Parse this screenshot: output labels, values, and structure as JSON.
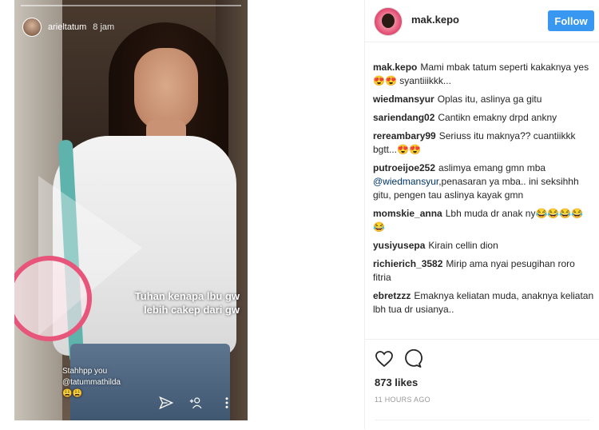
{
  "story": {
    "username": "arieltatum",
    "time": "8 jam",
    "caption_line1": "Tuhan kenapa lbu gw",
    "caption_line2": "lebih cakep dari gw",
    "reply_line1": "Stahhpp you",
    "reply_line2": "@tatummathilda",
    "reply_emoji": "😩😩",
    "footer_icons": [
      "send-icon",
      "add-person-icon",
      "more-icon"
    ]
  },
  "post": {
    "username": "mak.kepo",
    "follow_label": "Follow",
    "likes": "873 likes",
    "timestamp": "11 HOURS AGO",
    "accent_color": "#3897f0"
  },
  "comments": [
    {
      "user": "mak.kepo",
      "text": "Mami mbak tatum seperti kakaknya yes 😍😍 syantiiikkk..."
    },
    {
      "user": "wiedmansyur",
      "text": "Oplas itu, aslinya ga gitu"
    },
    {
      "user": "sariendang02",
      "text": "Cantikn emakny drpd ankny"
    },
    {
      "user": "rereambary99",
      "text": "Seriuss itu maknya?? cuantiikkk bgtt...😍😍"
    },
    {
      "user": "putroeijoe252",
      "text": "aslimya emang gmn mba",
      "mention": "@wiedmansyur",
      "text2": ",penasaran ya mba.. ini seksihhh gitu, pengen tau aslinya kayak gmn"
    },
    {
      "user": "momskie_anna",
      "text": "Lbh muda dr anak ny😂😂😂😂😂"
    },
    {
      "user": "yusiyusepa",
      "text": "Kirain cellin dion"
    },
    {
      "user": "richierich_3582",
      "text": "Mirip ama nyai pesugihan roro fitria"
    },
    {
      "user": "ebretzzz",
      "text": "Emaknya keliatan muda, anaknya keliatan lbh tua dr usianya.."
    }
  ]
}
